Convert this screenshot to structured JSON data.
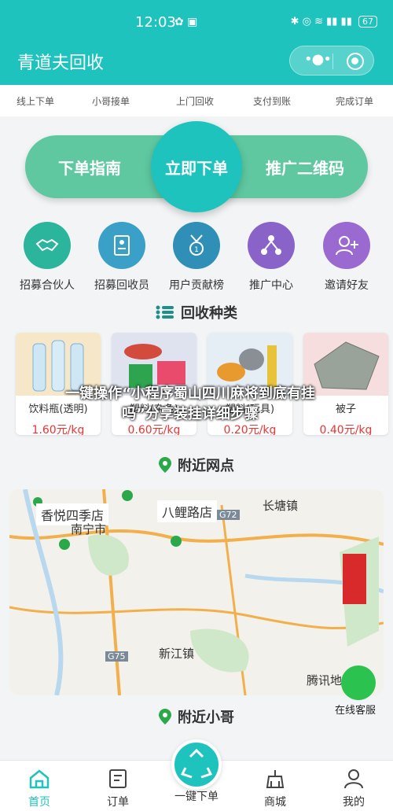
{
  "status_bar": {
    "time": "12:03",
    "battery": "67"
  },
  "header": {
    "title": "青道夫回收"
  },
  "steps": [
    "线上下单",
    "小哥接单",
    "上门回收",
    "支付到账",
    "完成订单"
  ],
  "action_bar": {
    "left": "下单指南",
    "center": "立即下单",
    "right": "推广二维码"
  },
  "shortcuts": [
    {
      "label": "招募合伙人",
      "icon": "handshake-icon",
      "color": "#2bb59c"
    },
    {
      "label": "招募回收员",
      "icon": "recruit-form-icon",
      "color": "#3aa0c8"
    },
    {
      "label": "用户贡献榜",
      "icon": "medal-icon",
      "color": "#2f8fb6"
    },
    {
      "label": "推广中心",
      "icon": "share-network-icon",
      "color": "#8a63c9"
    },
    {
      "label": "邀请好友",
      "icon": "add-user-icon",
      "color": "#9a6ad0"
    }
  ],
  "categories_title": "回收种类",
  "categories": [
    {
      "name": "饮料瓶(透明)",
      "price": "1.60元/kg"
    },
    {
      "name": "塑料(杂色)",
      "price": "0.60元/kg"
    },
    {
      "name": "塑料(玩具)",
      "price": "0.20元/kg"
    },
    {
      "name": "被子",
      "price": "0.40元/kg"
    }
  ],
  "overlay_banner": "一键操作“小程序蜀山四川麻将到底有挂吗”分享装挂详细步骤",
  "nearby_points_title": "附近网点",
  "map_labels": {
    "hotel": "香悦四季店",
    "road": "八鲤路店",
    "changtang": "长塘镇",
    "g72": "G72",
    "g75": "G75",
    "xinjiang": "新江镇",
    "nanning": "南宁市",
    "tencent": "腾讯地图"
  },
  "service_label": "在线客服",
  "nearby_courier_title": "附近小哥",
  "tabs": [
    {
      "label": "首页",
      "icon": "home-icon"
    },
    {
      "label": "订单",
      "icon": "order-icon"
    },
    {
      "label": "一键下单",
      "icon": "recycle-icon"
    },
    {
      "label": "商城",
      "icon": "shop-icon"
    },
    {
      "label": "我的",
      "icon": "profile-icon"
    }
  ],
  "colors": {
    "brand": "#1fc3bd",
    "price": "#e33333"
  }
}
